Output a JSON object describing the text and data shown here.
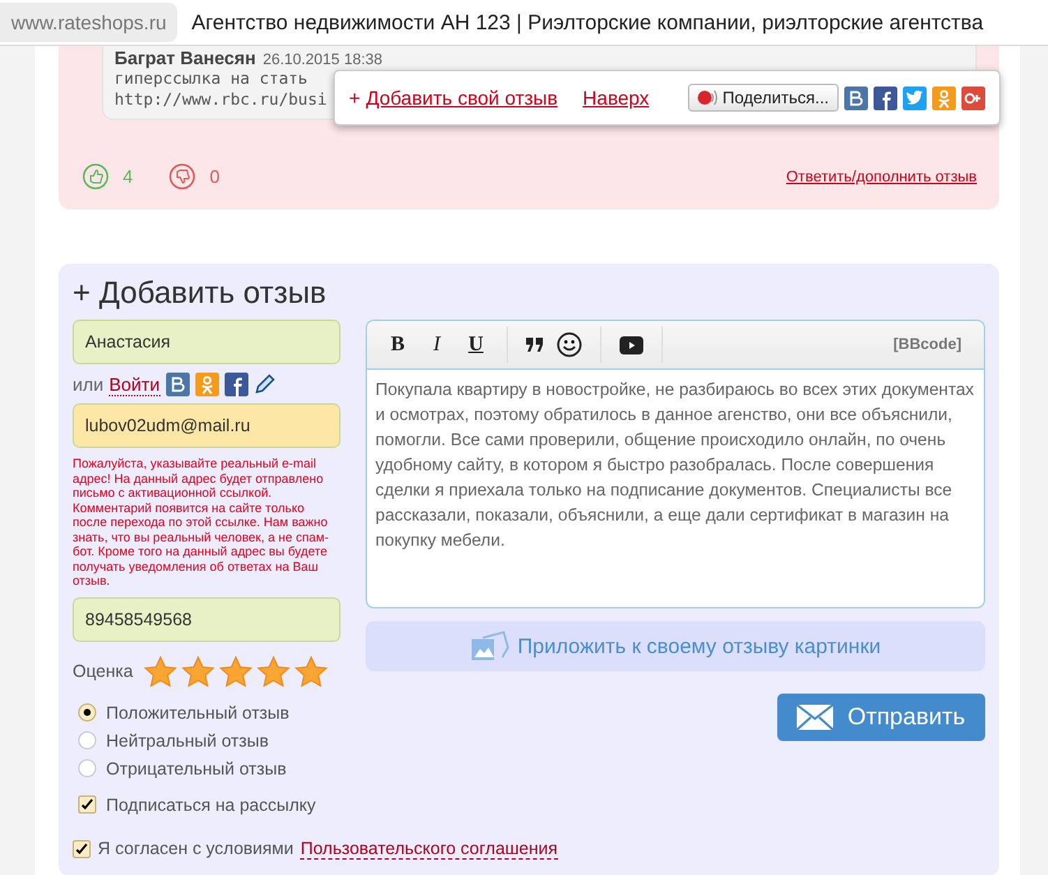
{
  "browser": {
    "url": "www.rateshops.ru",
    "title": "Агентство недвижимости АН 123 | Риэлторские компании, риэлторские агентства"
  },
  "comment": {
    "author": "Баграт Ванесян",
    "date": "26.10.2015 18:38",
    "lines": [
      "гиперссылка на стать",
      "http://www.rbc.ru/busi"
    ],
    "likes": "4",
    "dislikes": "0",
    "reply_link": "Ответить/дополнить отзыв"
  },
  "float_bar": {
    "plus": "+",
    "add_link": "Добавить свой отзыв",
    "top_link": "Наверх",
    "share": "Поделиться..."
  },
  "form": {
    "title": "+ Добавить отзыв",
    "name": "Анастасия",
    "or": "или",
    "login": "Войти",
    "email": "lubov02udm@mail.ru",
    "warning": "Пожалуйста, указывайте реальный e-mail адрес! На данный адрес будет отправлено письмо с активационной ссылкой. Комментарий появится на сайте только после перехода по этой ссылке. Нам важно знать, что вы реальный человек, а не спам-бот. Кроме того на данный адрес вы будете получать уведомления об ответах на Ваш отзыв.",
    "phone": "89458549568",
    "rating_label": "Оценка",
    "stars": 5,
    "radios": [
      {
        "label": "Положительный отзыв",
        "selected": true
      },
      {
        "label": "Нейтральный отзыв",
        "selected": false
      },
      {
        "label": "Отрицательный отзыв",
        "selected": false
      }
    ],
    "subscribe": {
      "label": "Подписаться на рассылку",
      "checked": true
    },
    "agree": {
      "text": "Я согласен с условиями",
      "link": "Пользовательского соглашения",
      "checked": true
    },
    "editor": {
      "format_buttons": [
        {
          "kind": "bold",
          "label": "B"
        },
        {
          "kind": "italic",
          "label": "I"
        },
        {
          "kind": "underline",
          "label": "U"
        }
      ],
      "mode": "[BBcode]",
      "text": "Покупала квартиру в новостройке, не разбираюсь во всех этих документах и осмотрах, поэтому обратилось в данное агенство, они все объяснили, помогли. Все сами проверили, общение происходило онлайн, по очень удобному сайту, в котором я быстро разобралась. После совершения сделки я приехала только на подписание документов. Специалисты все рассказали, показали, объяснили, а еще дали сертификат в магазин на покупку мебели."
    },
    "attach": "Приложить к своему отзыву картинки",
    "submit": "Отправить"
  }
}
